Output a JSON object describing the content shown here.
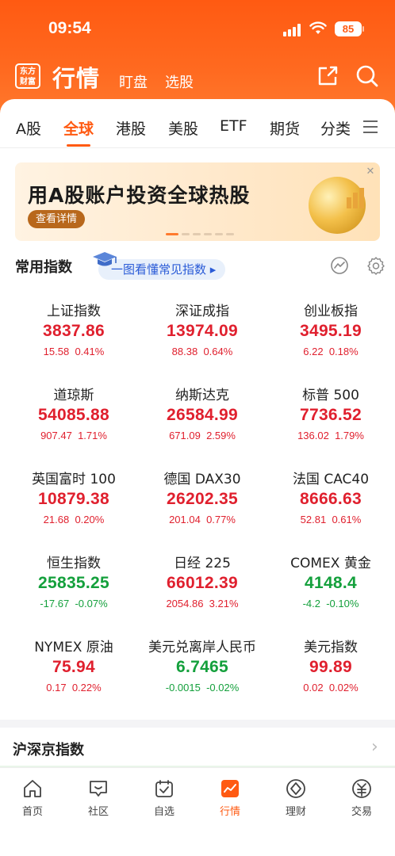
{
  "status_bar": {
    "time": "09:54",
    "battery": "85"
  },
  "app_bar": {
    "logo_line1": "东方",
    "logo_line2": "财富",
    "title": "行情",
    "links": [
      "盯盘",
      "选股"
    ]
  },
  "tabs": [
    {
      "label": "A股",
      "active": false
    },
    {
      "label": "全球",
      "active": true
    },
    {
      "label": "港股",
      "active": false
    },
    {
      "label": "美股",
      "active": false
    },
    {
      "label": "ETF",
      "active": false
    },
    {
      "label": "期货",
      "active": false
    },
    {
      "label": "分类",
      "active": false
    }
  ],
  "banner": {
    "title": "用A股账户投资全球热股",
    "button": "查看详情",
    "close": "✕"
  },
  "common_indices": {
    "title": "常用指数",
    "guide_link": "一图看懂常见指数 ▸",
    "items": [
      {
        "name": "上证指数",
        "price": "3837.86",
        "change": "15.58",
        "pct": "0.41%",
        "dir": "up"
      },
      {
        "name": "深证成指",
        "price": "13974.09",
        "change": "88.38",
        "pct": "0.64%",
        "dir": "up"
      },
      {
        "name": "创业板指",
        "price": "3495.19",
        "change": "6.22",
        "pct": "0.18%",
        "dir": "up"
      },
      {
        "name": "道琼斯",
        "price": "54085.88",
        "change": "907.47",
        "pct": "1.71%",
        "dir": "up"
      },
      {
        "name": "纳斯达克",
        "price": "26584.99",
        "change": "671.09",
        "pct": "2.59%",
        "dir": "up"
      },
      {
        "name": "标普 500",
        "price": "7736.52",
        "change": "136.02",
        "pct": "1.79%",
        "dir": "up"
      },
      {
        "name": "英国富时 100",
        "price": "10879.38",
        "change": "21.68",
        "pct": "0.20%",
        "dir": "up"
      },
      {
        "name": "德国 DAX30",
        "price": "26202.35",
        "change": "201.04",
        "pct": "0.77%",
        "dir": "up"
      },
      {
        "name": "法国 CAC40",
        "price": "8666.63",
        "change": "52.81",
        "pct": "0.61%",
        "dir": "up"
      },
      {
        "name": "恒生指数",
        "price": "25835.25",
        "change": "-17.67",
        "pct": "-0.07%",
        "dir": "down"
      },
      {
        "name": "日经 225",
        "price": "66012.39",
        "change": "2054.86",
        "pct": "3.21%",
        "dir": "up"
      },
      {
        "name": "COMEX 黄金",
        "price": "4148.4",
        "change": "-4.2",
        "pct": "-0.10%",
        "dir": "down"
      },
      {
        "name": "NYMEX 原油",
        "price": "75.94",
        "change": "0.17",
        "pct": "0.22%",
        "dir": "up"
      },
      {
        "name": "美元兑离岸人民币",
        "price": "6.7465",
        "change": "-0.0015",
        "pct": "-0.02%",
        "dir": "down"
      },
      {
        "name": "美元指数",
        "price": "99.89",
        "change": "0.02",
        "pct": "0.02%",
        "dir": "up"
      }
    ]
  },
  "section2": {
    "title": "沪深京指数",
    "chevron": "›"
  },
  "tabbar": [
    {
      "label": "首页",
      "icon": "home-icon",
      "active": false
    },
    {
      "label": "社区",
      "icon": "community-icon",
      "active": false
    },
    {
      "label": "自选",
      "icon": "watchlist-icon",
      "active": false
    },
    {
      "label": "行情",
      "icon": "market-icon",
      "active": true
    },
    {
      "label": "理财",
      "icon": "wealth-icon",
      "active": false
    },
    {
      "label": "交易",
      "icon": "trade-icon",
      "active": false
    }
  ],
  "colors": {
    "brand": "#ff5a12",
    "up": "#e0202e",
    "down": "#14a03c"
  }
}
